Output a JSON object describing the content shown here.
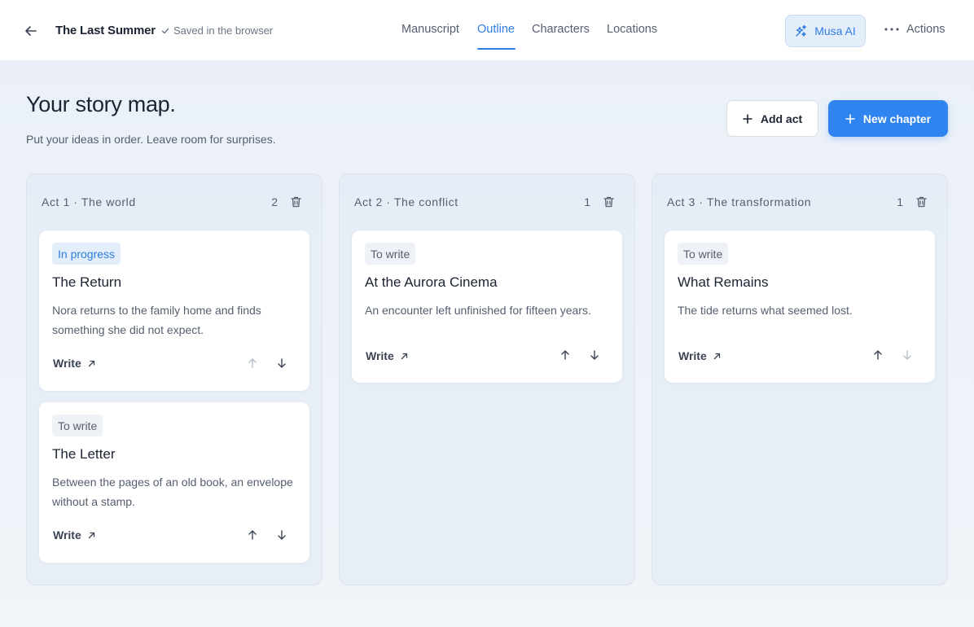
{
  "header": {
    "doc_title": "The Last Summer",
    "saved_status": "Saved in the browser",
    "tabs": [
      {
        "label": "Manuscript"
      },
      {
        "label": "Outline"
      },
      {
        "label": "Characters"
      },
      {
        "label": "Locations"
      }
    ],
    "active_tab": "Outline",
    "ai_button": "Musa AI",
    "actions_button": "Actions"
  },
  "page": {
    "title": "Your story map.",
    "subtitle": "Put your ideas in order. Leave room for surprises.",
    "add_act_label": "Add act",
    "new_chapter_label": "New chapter"
  },
  "colors": {
    "accent": "#2f7de1",
    "primary_button": "#2f84ef",
    "text": "#1c2433",
    "muted": "#555f70"
  },
  "write_label": "Write",
  "acts": [
    {
      "title": "Act 1 · The world",
      "count": "2",
      "chapters": [
        {
          "status": "In progress",
          "title": "The Return",
          "description": "Nora returns to the family home and finds something she did not expect."
        },
        {
          "status": "To write",
          "title": "The Letter",
          "description": "Between the pages of an old book, an envelope without a stamp."
        }
      ]
    },
    {
      "title": "Act 2 · The conflict",
      "count": "1",
      "chapters": [
        {
          "status": "To write",
          "title": "At the Aurora Cinema",
          "description": "An encounter left unfinished for fifteen years."
        }
      ]
    },
    {
      "title": "Act 3 · The transformation",
      "count": "1",
      "chapters": [
        {
          "status": "To write",
          "title": "What Remains",
          "description": "The tide returns what seemed lost."
        }
      ]
    }
  ]
}
